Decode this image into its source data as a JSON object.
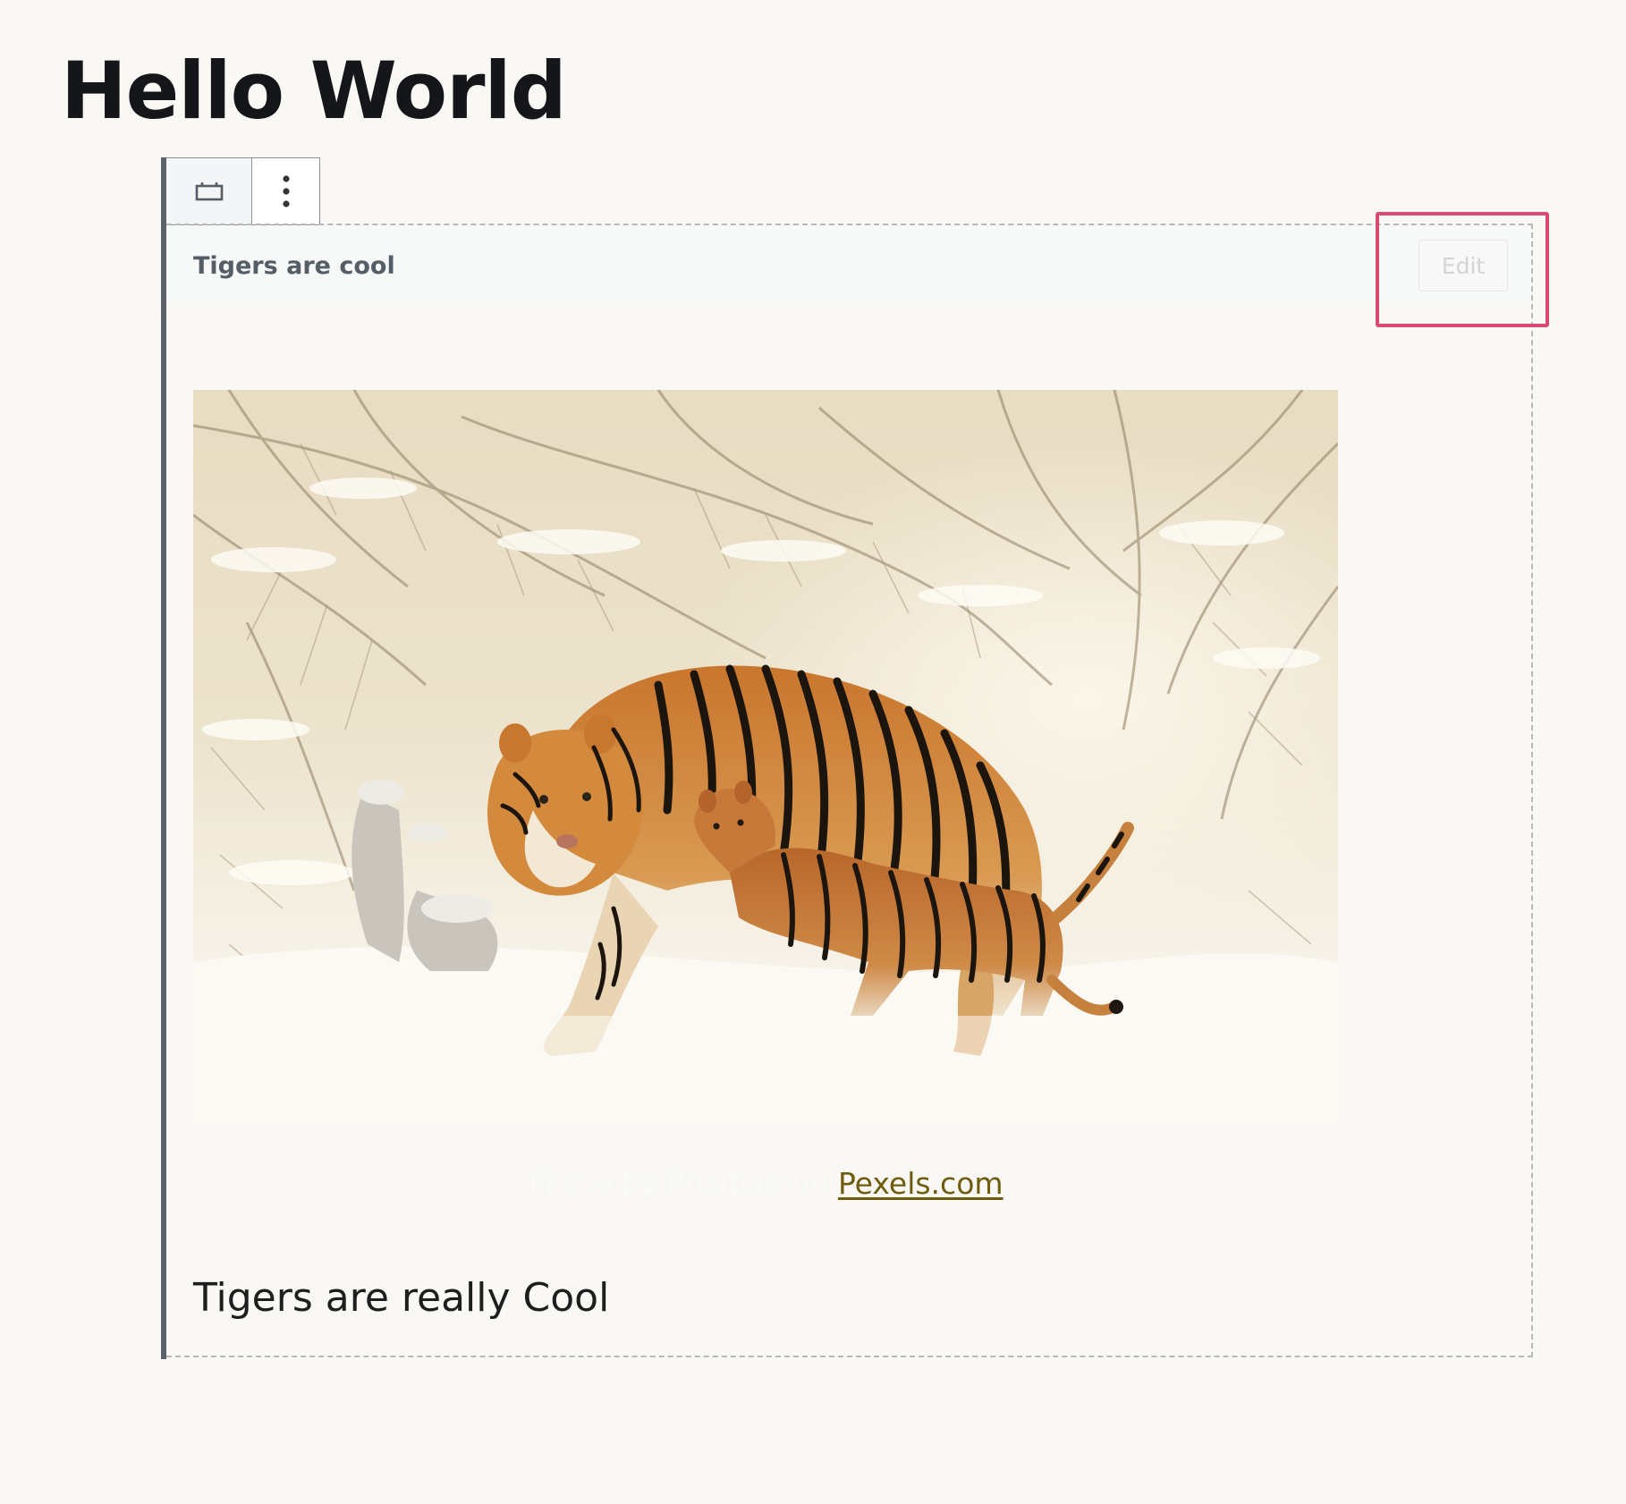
{
  "page": {
    "title": "Hello World"
  },
  "block": {
    "toolbar": {
      "block_type_icon": "embed-placeholder-icon",
      "more_options_icon": "more-vertical-icon"
    },
    "header_title": "Tigers are cool",
    "edit_label": "Edit",
    "image_alt": "Two tigers, a mother and cub, walking through a snowy forest",
    "caption": {
      "text": "Photo by Pixabay on ",
      "link_text": "Pexels.com"
    },
    "body_text": "Tigers are really Cool"
  },
  "colors": {
    "highlight": "#d94b72",
    "link": "#6f5c0e",
    "block_border": "#5d6169"
  }
}
